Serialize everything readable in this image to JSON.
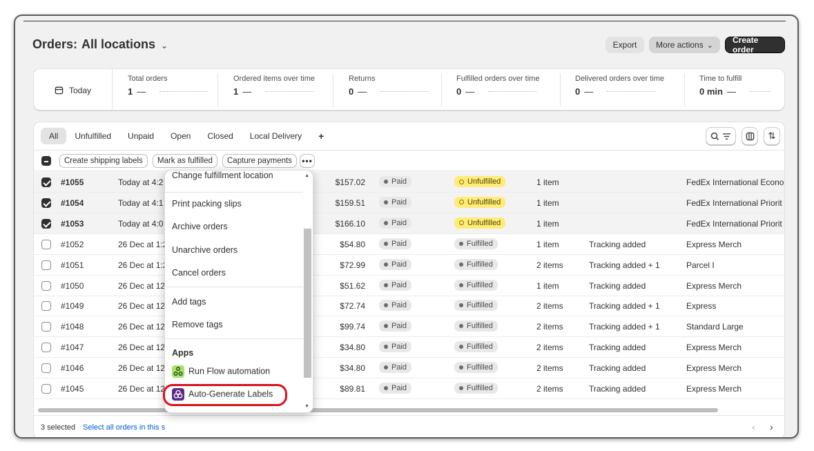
{
  "header": {
    "title": "Orders:",
    "location": "All locations",
    "export": "Export",
    "more_actions": "More actions",
    "create_order": "Create order"
  },
  "metrics": {
    "date": "Today",
    "items": [
      {
        "label": "Total orders",
        "value": "1",
        "dash": "—"
      },
      {
        "label": "Ordered items over time",
        "value": "1",
        "dash": "—"
      },
      {
        "label": "Returns",
        "value": "0",
        "dash": "—"
      },
      {
        "label": "Fulfilled orders over time",
        "value": "0",
        "dash": "—"
      },
      {
        "label": "Delivered orders over time",
        "value": "0",
        "dash": "—"
      },
      {
        "label": "Time to fulfill",
        "value": "0 min",
        "dash": "—"
      }
    ]
  },
  "tabs": [
    "All",
    "Unfulfilled",
    "Unpaid",
    "Open",
    "Closed",
    "Local Delivery",
    "+"
  ],
  "bulk": {
    "create_labels": "Create shipping labels",
    "mark_fulfilled": "Mark as fulfilled",
    "capture": "Capture payments",
    "more": "•••"
  },
  "rows": [
    {
      "id": "#1055",
      "date": "Today at 4:2",
      "total": "$157.02",
      "payment": "Paid",
      "fulfillment": "Unfulfilled",
      "items": "1 item",
      "delivery": "",
      "method": "FedEx International Econo"
    },
    {
      "id": "#1054",
      "date": "Today at 4:1",
      "total": "$159.51",
      "payment": "Paid",
      "fulfillment": "Unfulfilled",
      "items": "1 item",
      "delivery": "",
      "method": "FedEx International Priorit"
    },
    {
      "id": "#1053",
      "date": "Today at 4:0",
      "total": "$166.10",
      "payment": "Paid",
      "fulfillment": "Unfulfilled",
      "items": "1 item",
      "delivery": "",
      "method": "FedEx International Priorit"
    },
    {
      "id": "#1052",
      "date": "26 Dec at 1:2",
      "total": "$54.80",
      "payment": "Paid",
      "fulfillment": "Fulfilled",
      "items": "1 item",
      "delivery": "Tracking added",
      "method": "Express Merch"
    },
    {
      "id": "#1051",
      "date": "26 Dec at 1:2",
      "total": "$72.99",
      "payment": "Paid",
      "fulfillment": "Fulfilled",
      "items": "2 items",
      "delivery": "Tracking added + 1",
      "method": "Parcel I"
    },
    {
      "id": "#1050",
      "date": "26 Dec at 12",
      "total": "$51.62",
      "payment": "Paid",
      "fulfillment": "Fulfilled",
      "items": "1 item",
      "delivery": "Tracking added",
      "method": "Express Merch"
    },
    {
      "id": "#1049",
      "date": "26 Dec at 12",
      "total": "$72.74",
      "payment": "Paid",
      "fulfillment": "Fulfilled",
      "items": "2 items",
      "delivery": "Tracking added + 1",
      "method": "Express"
    },
    {
      "id": "#1048",
      "date": "26 Dec at 12",
      "total": "$99.74",
      "payment": "Paid",
      "fulfillment": "Fulfilled",
      "items": "2 items",
      "delivery": "Tracking added + 1",
      "method": "Standard Large"
    },
    {
      "id": "#1047",
      "date": "26 Dec at 12",
      "total": "$34.80",
      "payment": "Paid",
      "fulfillment": "Fulfilled",
      "items": "2 items",
      "delivery": "Tracking added",
      "method": "Express Merch"
    },
    {
      "id": "#1046",
      "date": "26 Dec at 12",
      "total": "$34.80",
      "payment": "Paid",
      "fulfillment": "Fulfilled",
      "items": "2 items",
      "delivery": "Tracking added",
      "method": "Express Merch"
    },
    {
      "id": "#1045",
      "date": "26 Dec at 12",
      "total": "$89.81",
      "payment": "Paid",
      "fulfillment": "Fulfilled",
      "items": "2 items",
      "delivery": "Tracking added",
      "method": "Express Merch"
    }
  ],
  "selected_ids": [
    "#1055",
    "#1054",
    "#1053"
  ],
  "footer": {
    "count": "3 selected",
    "select_all": "Select all orders in this s"
  },
  "menu": {
    "change_location": "Change fulfillment location",
    "print_slips": "Print packing slips",
    "archive": "Archive orders",
    "unarchive": "Unarchive orders",
    "cancel": "Cancel orders",
    "add_tags": "Add tags",
    "remove_tags": "Remove tags",
    "apps_heading": "Apps",
    "run_flow": "Run Flow automation",
    "auto_labels": "Auto-Generate Labels"
  },
  "colors": {
    "primary_dark": "#303030",
    "unfulfilled_badge": "#ffeb78",
    "link": "#005bd3",
    "highlight": "#d9101a"
  }
}
